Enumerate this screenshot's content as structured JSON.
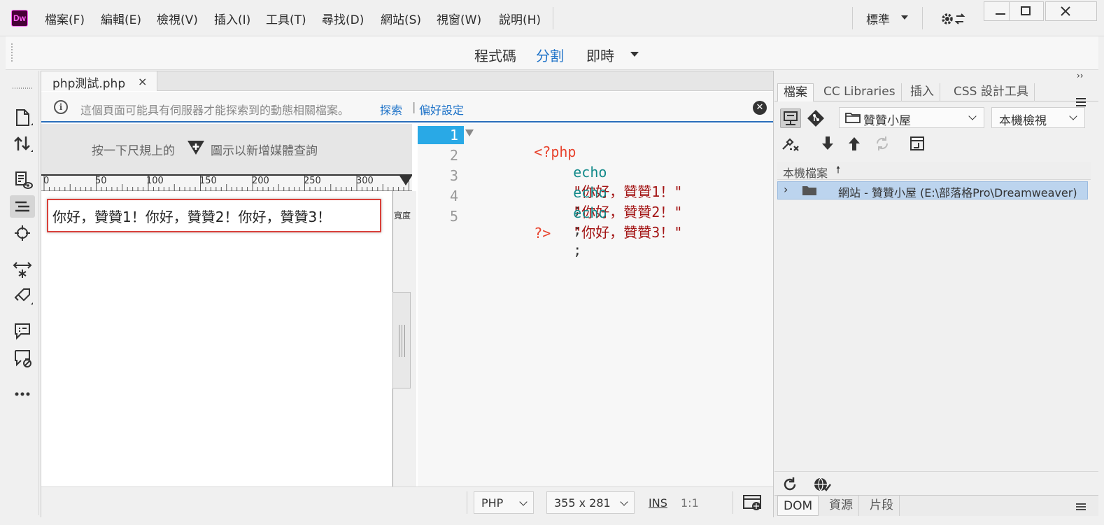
{
  "app": {
    "logo": "Dw",
    "menu": [
      "檔案(F)",
      "編輯(E)",
      "檢視(V)",
      "插入(I)",
      "工具(T)",
      "尋找(D)",
      "網站(S)",
      "視窗(W)",
      "說明(H)"
    ],
    "workspace": "標準",
    "window_buttons": [
      "minimize-icon",
      "maximize-icon",
      "close-icon"
    ]
  },
  "view_modes": {
    "code": "程式碼",
    "split": "分割",
    "live": "即時",
    "active": "split",
    "accent": "#1f73c8"
  },
  "document": {
    "tab_name": "php測試.php",
    "tab_close": "×",
    "infobar": {
      "message": "這個頁面可能具有伺服器才能探索到的動態相關檔案。",
      "link_explore": "探索",
      "separator": "|",
      "link_prefs": "偏好設定"
    },
    "live": {
      "mq_text_1": "按一下尺規上的",
      "mq_text_2": "圖示以新增媒體查詢",
      "ruler_labels": [
        "0",
        "50",
        "100",
        "150",
        "200",
        "250",
        "300"
      ],
      "output_text": "你好，贊贊1！你好，贊贊2！你好，贊贊3！",
      "width_label": "寬度"
    },
    "code": {
      "line_numbers": [
        "1",
        "2",
        "3",
        "4",
        "5"
      ],
      "open_tag": "<?php",
      "lines": [
        {
          "kw": "echo",
          "str": "\"你好，贊贊1！\"",
          "punc": ";"
        },
        {
          "kw": "echo",
          "str": "\"你好，贊贊2！\"",
          "punc": ";"
        },
        {
          "kw": "echo",
          "str": "\"你好，贊贊3！\"",
          "punc": ";"
        }
      ],
      "close_tag": "?>"
    },
    "status": {
      "language": "PHP",
      "size": "355 x 281",
      "ins": "INS",
      "position": "1:1"
    }
  },
  "right_panel": {
    "tabs": [
      "檔案",
      "CC Libraries",
      "插入",
      "CSS 設計工具"
    ],
    "site_select": "贊贊小屋",
    "view_select": "本機檢視",
    "files_header": "本機檔案",
    "site_row": "網站 - 贊贊小屋 (E:\\部落格Pro\\Dreamweaver)",
    "bottom_tabs": [
      "DOM",
      "資源",
      "片段"
    ]
  }
}
